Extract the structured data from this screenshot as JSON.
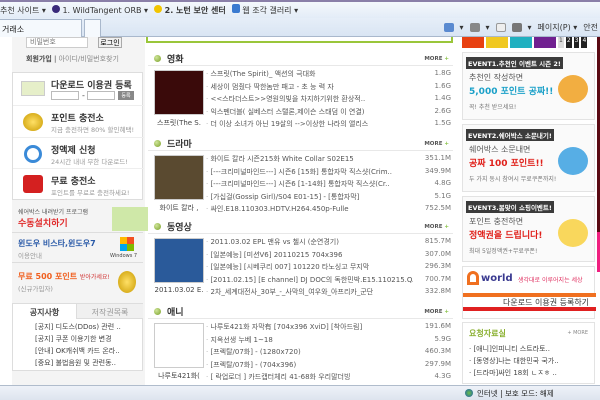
{
  "browser": {
    "favorites": [
      {
        "label": "추천 사이트 ▾"
      },
      {
        "label": "1. WildTangent ORB ▾"
      },
      {
        "label": "2. 노턴 보안 센터"
      },
      {
        "label": "웹 조각 갤러리 ▾"
      }
    ],
    "active_tab": "거래소",
    "command_bar": {
      "page_label": "페이지(P) ▾",
      "safety_label": "안전"
    },
    "status": {
      "zone": "인터넷 | 보호 모드: 해제"
    }
  },
  "login": {
    "password_placeholder": "비밀번호",
    "login_button": "로그인",
    "signup": "회원가입",
    "find": "아이디/비밀번호찾기"
  },
  "left_menu": [
    {
      "title": "다운로드 이용권 등록",
      "sub": "",
      "button": "등록"
    },
    {
      "title": "포인트 충전소",
      "sub": "지금 충전하면 80% 할인혜택!"
    },
    {
      "title": "정액제 신청",
      "sub": "24시간 내내 무한 다운로드!"
    },
    {
      "title": "무료 충전소",
      "sub": "포인트를 무료로 충전하세요!"
    }
  ],
  "banners": {
    "manual": {
      "line1": "쉐어박스 내려받기 프로그램",
      "line2": "수동설치하기",
      "go": "GO"
    },
    "windows": {
      "line1": "윈도우 비스타,윈도우7",
      "line2": "이용안내",
      "logo": "Windows 7"
    },
    "free": {
      "line1": "무료 500 포인트",
      "line1b": "받아가세요!",
      "line2": "(신규가입자)"
    }
  },
  "notice": {
    "tabs": [
      "공지사항",
      "저작권목록"
    ],
    "items": [
      "[공지] 디도스(DDos) 관련 ..",
      "[공지] 쿠폰 이용기한 변경",
      "[안내] OK캐쉬백 카드 온라..",
      "[중요] 불법음원 및 관련동.."
    ]
  },
  "sections": [
    {
      "title": "영화",
      "more": "MORE",
      "caption": "스프릿(The S.",
      "thumb": "#3a0a0a",
      "rows": [
        [
          "스프릿(The Spirit)_ 액션의 극대화",
          "1.8G"
        ],
        [
          "세상이 멈췄다 딱한놈만 패고 - 초 능 력 자",
          "1.6G"
        ],
        [
          "<<스타더스트>>영원의빛을 차지하기위한 환상적..",
          "1.4G"
        ],
        [
          "익스펜더블( 실베스터 스탤론,제이슨 스태덤 이 연결)",
          "2.6G"
        ],
        [
          "더 이상 소녀가 아닌 19살의 -->이상한 나라의 앨리스",
          "1.5G"
        ]
      ]
    },
    {
      "title": "드라마",
      "more": "MORE",
      "caption": "화이트 칼라 ,",
      "thumb": "#5a4a30",
      "rows": [
        [
          "화이트 칼라 시즌215화 White Collar S02E15",
          "351.1M"
        ],
        [
          "[---크리미널마인드---] 시즌6 [15화] 통합자막 직스샷(Crim..",
          "349.9M"
        ],
        [
          "[---크리미널마인드---] 시즌6 [1-14화] 통합자막 직스샷(Cr..",
          "4.8G"
        ],
        [
          "[가십걸(Gossip Girl)/S04 E01-15] - [통합자막]",
          "5.1G"
        ],
        [
          "싸인.E18.110303.HDTV.H264.450p-Fulle",
          "752.5M"
        ]
      ]
    },
    {
      "title": "동영상",
      "more": "MORE",
      "caption": "2011.03.02 E.",
      "thumb": "#2a5a9a",
      "rows": [
        [
          "2011.03.02 EPL 맨유 vs 첼시 (순연경기)",
          "815.7M"
        ],
        [
          "[일본예능] [미션V6] 20110215 704x396",
          "307.0M"
        ],
        [
          "[일본예능] [시베쿠리 007] 101220 타노싱고 무지막",
          "296.3M"
        ],
        [
          "[2011.02.15] [E channel] DJ DOC의 독한민박.E15.110215.QAML.",
          "700.7M"
        ],
        [
          "2차_세계대전사_30부_-_사막의_여우와_아프리카_군단",
          "332.8M"
        ]
      ]
    },
    {
      "title": "애니",
      "more": "MORE",
      "caption": "나루토421화(",
      "thumb": "#ffffff",
      "rows": [
        [
          "나루토421화 자막有 [704x396 XviD] [착아드림]",
          "191.6M"
        ],
        [
          "지옥선생 누베 1~18",
          "5.9G"
        ],
        [
          "[프렉탈/07화] - (1280x720)",
          "460.3M"
        ],
        [
          "[프렉탈/07화] - (704x396)",
          "297.9M"
        ],
        [
          "[ 락업로더 ] 카드캡터체리 41-68화 우리말더빙",
          "4.3G"
        ]
      ]
    }
  ],
  "events": [
    {
      "tag": "EVENT1.추천인 이벤트 시즌 2!",
      "l1": "추천인 작성하면",
      "l2": "5,000 포인트 공짜!!",
      "l3": "꼭! 추천 받으세요!",
      "c": "#1aa0c8"
    },
    {
      "tag": "EVENT2.쉐어박스 소문내기!",
      "l1": "쉐어박스 소문내면",
      "l2": "공짜 100 포인트!!",
      "l3": "두 가지 동시 참여시 무료쿠폰까지!",
      "c": "#e0201a"
    },
    {
      "tag": "EVENT3.봄맞이 쇼핑이벤트!",
      "l1": "포인트 충전하면",
      "l2": "정액권을 드립니다!",
      "l3": "최대 5일정액권+무료쿠폰!",
      "c": "#e0201a"
    }
  ],
  "rotator_pages": [
    "1",
    "2",
    "3",
    "4"
  ],
  "tworld": {
    "brand": "world",
    "slogan": "생각대로 이루어지는 세상",
    "cta": "다운로드 이용권 등록하기"
  },
  "requests": {
    "title": "요청자료실",
    "more": "MORE",
    "items": [
      "[애니]인피니티 스트라토..",
      "[동영상]나는 대한민국 국가..",
      "[드라마]싸인 18회 ㄴㅈㅎ .."
    ]
  }
}
